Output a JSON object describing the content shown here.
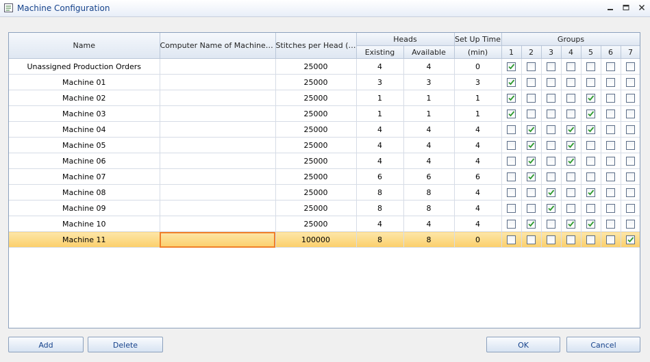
{
  "window": {
    "title": "Machine Configuration",
    "minimize_label": "–",
    "restore_label": "▭",
    "close_label": "✕"
  },
  "grid": {
    "columns": {
      "name": "Name",
      "computer_name": "Computer Name of Machine Cl...",
      "stitches": "Stitches per Head (h)",
      "heads": "Heads",
      "heads_existing": "Existing",
      "heads_available": "Available",
      "setup_time": "Set Up Time",
      "setup_unit": "(min)",
      "groups": "Groups",
      "group_numbers": [
        "1",
        "2",
        "3",
        "4",
        "5",
        "6",
        "7"
      ]
    },
    "selected_row": 11,
    "rows": [
      {
        "name": "Unassigned Production Orders",
        "computer_name": "",
        "stitches": "25000",
        "existing": "4",
        "available": "4",
        "setup": "0",
        "groups": [
          true,
          false,
          false,
          false,
          false,
          false,
          false
        ]
      },
      {
        "name": "Machine 01",
        "computer_name": "",
        "stitches": "25000",
        "existing": "3",
        "available": "3",
        "setup": "3",
        "groups": [
          true,
          false,
          false,
          false,
          false,
          false,
          false
        ]
      },
      {
        "name": "Machine 02",
        "computer_name": "",
        "stitches": "25000",
        "existing": "1",
        "available": "1",
        "setup": "1",
        "groups": [
          true,
          false,
          false,
          false,
          true,
          false,
          false
        ]
      },
      {
        "name": "Machine 03",
        "computer_name": "",
        "stitches": "25000",
        "existing": "1",
        "available": "1",
        "setup": "1",
        "groups": [
          true,
          false,
          false,
          false,
          true,
          false,
          false
        ]
      },
      {
        "name": "Machine 04",
        "computer_name": "",
        "stitches": "25000",
        "existing": "4",
        "available": "4",
        "setup": "4",
        "groups": [
          false,
          true,
          false,
          true,
          true,
          false,
          false
        ]
      },
      {
        "name": "Machine 05",
        "computer_name": "",
        "stitches": "25000",
        "existing": "4",
        "available": "4",
        "setup": "4",
        "groups": [
          false,
          true,
          false,
          true,
          false,
          false,
          false
        ]
      },
      {
        "name": "Machine 06",
        "computer_name": "",
        "stitches": "25000",
        "existing": "4",
        "available": "4",
        "setup": "4",
        "groups": [
          false,
          true,
          false,
          true,
          false,
          false,
          false
        ]
      },
      {
        "name": "Machine 07",
        "computer_name": "",
        "stitches": "25000",
        "existing": "6",
        "available": "6",
        "setup": "6",
        "groups": [
          false,
          true,
          false,
          false,
          false,
          false,
          false
        ]
      },
      {
        "name": "Machine 08",
        "computer_name": "",
        "stitches": "25000",
        "existing": "8",
        "available": "8",
        "setup": "4",
        "groups": [
          false,
          false,
          true,
          false,
          true,
          false,
          false
        ]
      },
      {
        "name": "Machine 09",
        "computer_name": "",
        "stitches": "25000",
        "existing": "8",
        "available": "8",
        "setup": "4",
        "groups": [
          false,
          false,
          true,
          false,
          false,
          false,
          false
        ]
      },
      {
        "name": "Machine 10",
        "computer_name": "",
        "stitches": "25000",
        "existing": "4",
        "available": "4",
        "setup": "4",
        "groups": [
          false,
          true,
          false,
          true,
          true,
          false,
          false
        ]
      },
      {
        "name": "Machine 11",
        "computer_name": "",
        "stitches": "100000",
        "existing": "8",
        "available": "8",
        "setup": "0",
        "groups": [
          false,
          false,
          false,
          false,
          false,
          false,
          true
        ]
      }
    ]
  },
  "buttons": {
    "add": "Add",
    "delete": "Delete",
    "ok": "OK",
    "cancel": "Cancel"
  },
  "colors": {
    "selection": "#fbcf6b",
    "edit_outline": "#f07f2a",
    "check": "#2e9a2e",
    "header_text": "#15428b"
  }
}
